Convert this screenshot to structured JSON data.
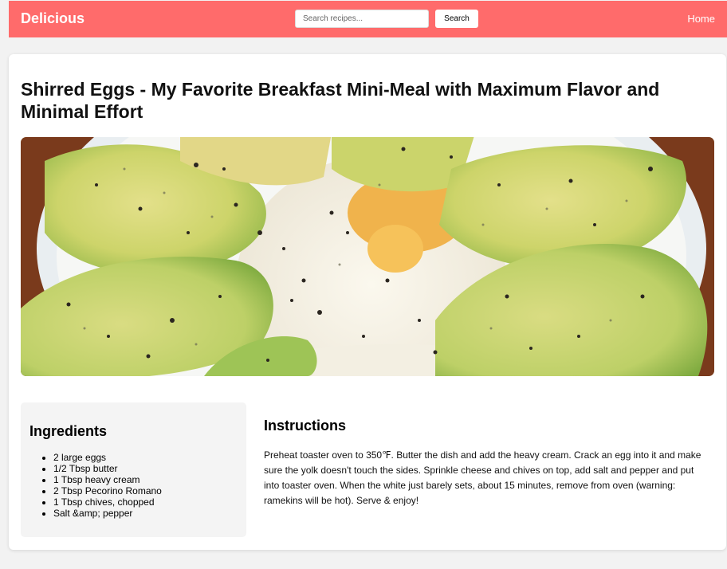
{
  "header": {
    "logo": "Delicious",
    "search_placeholder": "Search recipes...",
    "search_button": "Search",
    "nav_home": "Home"
  },
  "recipe": {
    "title": "Shirred Eggs - My Favorite Breakfast Mini-Meal with Maximum Flavor and Minimal Effort",
    "ingredients_heading": "Ingredients",
    "ingredients": [
      "2 large eggs",
      "1/2 Tbsp butter",
      "1 Tbsp heavy cream",
      "2 Tbsp Pecorino Romano",
      "1 Tbsp chives, chopped",
      "Salt &amp; pepper"
    ],
    "instructions_heading": "Instructions",
    "instructions": "Preheat toaster oven to 350℉. Butter the dish and add the heavy cream. Crack an egg into it and make sure the yolk doesn't touch the sides. Sprinkle cheese and chives on top, add salt and pepper and put into toaster oven. When the white just barely sets, about 15 minutes, remove from oven (warning: ramekins will be hot). Serve & enjoy!"
  },
  "colors": {
    "header_bg": "#ff6b6b",
    "panel_bg": "#f4f4f4"
  }
}
